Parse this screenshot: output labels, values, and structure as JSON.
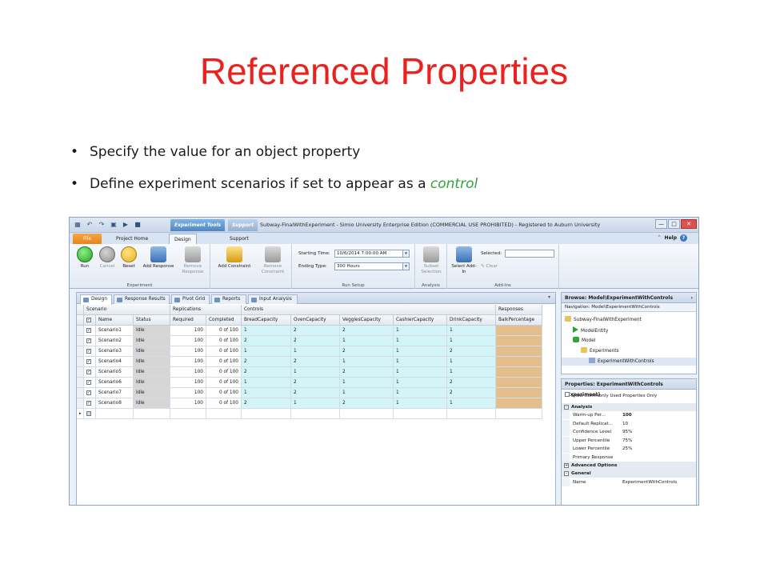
{
  "slide": {
    "title": "Referenced Properties",
    "bullet1": "Specify the value for an object property",
    "bullet2_pre": "Define experiment scenarios if set to appear as a ",
    "bullet2_hl": "control"
  },
  "window": {
    "title": "Subway-FinalWithExperiment - Simio University Enterprise Edition (COMMERCIAL USE PROHIBITED) - Registered to Auburn University",
    "context_tab_experiment": "Experiment Tools",
    "context_tab_support": "Support",
    "tabs": [
      "File",
      "Project Home",
      "Design",
      "Support"
    ],
    "help": "Help"
  },
  "ribbon": {
    "run": "Run",
    "cancel": "Cancel",
    "reset": "Reset",
    "add_response": "Add Response",
    "remove_response": "Remove Response",
    "add_constraint": "Add Constraint",
    "remove_constraint": "Remove Constraint",
    "group_experiment": "Experiment",
    "starting_time_label": "Starting Time:",
    "starting_time_value": "10/6/2014 7:00:00 AM",
    "ending_type_label": "Ending Type:",
    "ending_type_value": "300 Hours",
    "group_run_setup": "Run Setup",
    "subset_selection": "Subset Selection",
    "group_analysis": "Analysis",
    "select_addin": "Select Add-In",
    "selected_label": "Selected:",
    "clear": "Clear",
    "group_addins": "Add-Ins"
  },
  "doc_tabs": [
    "Design",
    "Response Results",
    "Pivot Grid",
    "Reports",
    "Input Analysis"
  ],
  "grid": {
    "groups": {
      "scenario": "Scenario",
      "replications": "Replications",
      "controls": "Controls",
      "responses": "Responses"
    },
    "columns": [
      "Name",
      "Status",
      "Required",
      "Completed",
      "BreadCapacity",
      "OvenCapacity",
      "VeggiesCapacity",
      "CashierCapacity",
      "DrinkCapacity",
      "BalkPercentage"
    ],
    "rows": [
      [
        "Scenario1",
        "Idle",
        "100",
        "0 of 100",
        "1",
        "2",
        "2",
        "1",
        "1",
        ""
      ],
      [
        "Scenario2",
        "Idle",
        "100",
        "0 of 100",
        "2",
        "2",
        "1",
        "1",
        "1",
        ""
      ],
      [
        "Scenario3",
        "Idle",
        "100",
        "0 of 100",
        "1",
        "1",
        "2",
        "1",
        "2",
        ""
      ],
      [
        "Scenario4",
        "Idle",
        "100",
        "0 of 100",
        "2",
        "2",
        "1",
        "1",
        "1",
        ""
      ],
      [
        "Scenario5",
        "Idle",
        "100",
        "0 of 100",
        "2",
        "1",
        "2",
        "1",
        "1",
        ""
      ],
      [
        "Scenario6",
        "Idle",
        "100",
        "0 of 100",
        "1",
        "2",
        "1",
        "1",
        "2",
        ""
      ],
      [
        "Scenario7",
        "Idle",
        "100",
        "0 of 100",
        "1",
        "2",
        "1",
        "1",
        "2",
        ""
      ],
      [
        "Scenario8",
        "Idle",
        "100",
        "0 of 100",
        "2",
        "1",
        "2",
        "1",
        "1",
        ""
      ]
    ]
  },
  "browse": {
    "title": "Browse: Model\\ExperimentWithControls",
    "nav": "Navigation: Model\\ExperimentWithControls",
    "tree": [
      "Subway-FinalWithExperiment",
      "ModelEntity",
      "Model",
      "Experiments",
      "ExperimentWithControls"
    ]
  },
  "properties": {
    "title": "Properties: ExperimentWithControls (Experiment)",
    "show_common": "Show Commonly Used Properties Only",
    "cat_analysis": "Analysis",
    "rows": [
      [
        "Warm-up Per...",
        "100"
      ],
      [
        "Default Replicat...",
        "10"
      ],
      [
        "Confidence Level",
        "95%"
      ],
      [
        "Upper Percentile",
        "75%"
      ],
      [
        "Lower Percentile",
        "25%"
      ],
      [
        "Primary Response",
        ""
      ]
    ],
    "cat_advanced": "Advanced Options",
    "cat_general": "General",
    "general_rows": [
      [
        "Name",
        "ExperimentWithControls"
      ]
    ]
  }
}
